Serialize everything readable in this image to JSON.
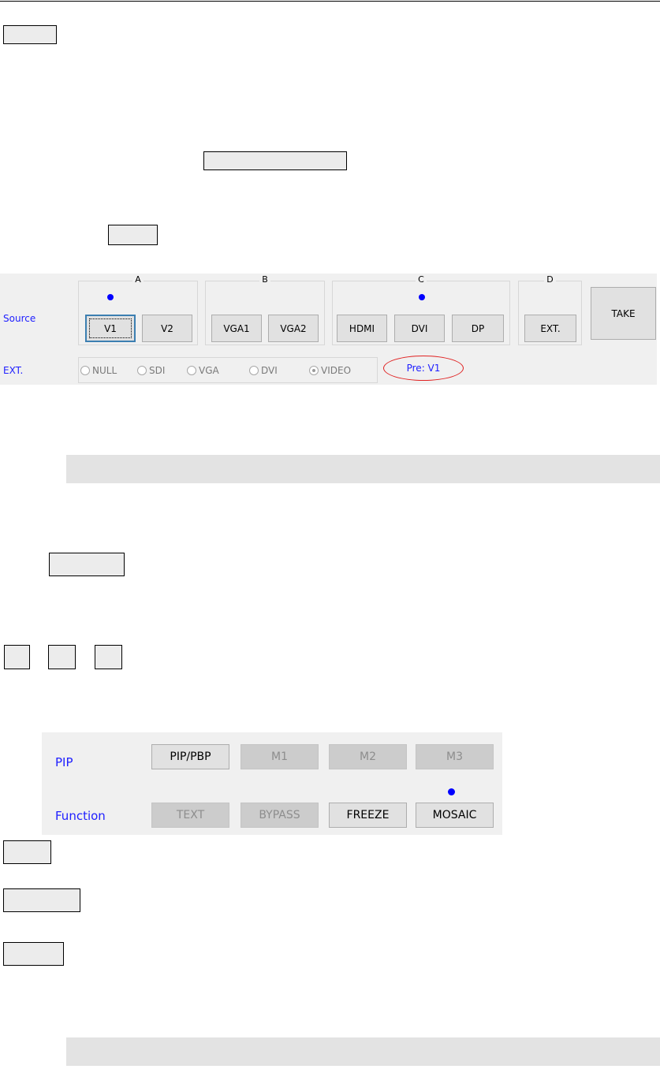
{
  "source_panel": {
    "row_source_label": "Source",
    "row_ext_label": "EXT.",
    "groups": [
      {
        "title": "A",
        "buttons": [
          "V1",
          "V2"
        ]
      },
      {
        "title": "B",
        "buttons": [
          "VGA1",
          "VGA2"
        ]
      },
      {
        "title": "C",
        "buttons": [
          "HDMI",
          "DVI",
          "DP"
        ]
      },
      {
        "title": "D",
        "buttons": [
          "EXT."
        ]
      }
    ],
    "take_label": "TAKE",
    "ext_options": [
      "NULL",
      "SDI",
      "VGA",
      "DVI",
      "VIDEO"
    ],
    "ext_selected": "VIDEO",
    "preview_text": "Pre: V1",
    "indicator_color": "#0000ff",
    "highlight_color": "#e02020"
  },
  "pip_panel": {
    "pip_label": "PIP",
    "function_label": "Function",
    "pip_buttons": [
      "PIP/PBP",
      "M1",
      "M2",
      "M3"
    ],
    "function_buttons": [
      "TEXT",
      "BYPASS",
      "FREEZE",
      "MOSAIC"
    ]
  }
}
